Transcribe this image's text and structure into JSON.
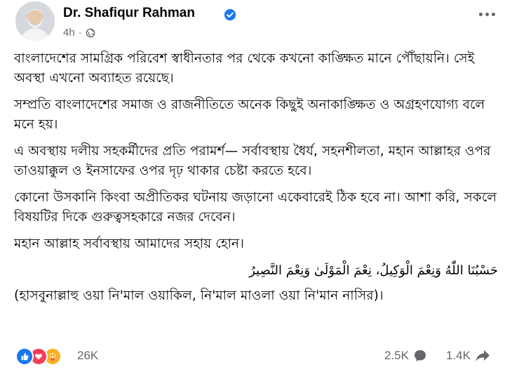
{
  "post": {
    "author": "Dr. Shafiqur Rahman",
    "time": "4h",
    "separator": "·",
    "paragraphs": [
      "বাংলাদেশের সামগ্রিক পরিবেশ স্বাধীনতার পর থেকে কখনো কাঙ্ক্ষিত মানে পৌঁছায়নি। সেই অবস্থা এখনো অব্যাহত রয়েছে।",
      "সম্প্রতি বাংলাদেশের সমাজ ও রাজনীতিতে অনেক কিছুই অনাকাঙ্ক্ষিত ও অগ্রহণযোগ্য বলে মনে হয়।",
      "এ অবস্থায় দলীয় সহকর্মীদের প্রতি পরামর্শ— সর্বাবস্থায় ধৈর্য, সহনশীলতা, মহান আল্লাহর ওপর তাওয়াক্কুল ও ইনসাফের ওপর দৃঢ় থাকার চেষ্টা করতে হবে।",
      "কোনো উসকানি কিংবা অপ্রীতিকর ঘটনায় জড়ানো একেবারেই ঠিক হবে না। আশা করি, সকলে বিষয়টির দিকে গুরুত্বসহকারে নজর দেবেন।",
      "মহান আল্লাহ সর্বাবস্থায় আমাদের সহায় হোন।"
    ],
    "arabic": "حَسْبُنَا اللّٰهُ وَنِعْمَ الْوَكِيلُ، نِعْمَ الْمَوْلَىٰ وَنِعْمَ النَّصِيرُ",
    "transliteration": "(হাসবুনাল্লাহু ওয়া নি'মাল ওয়াকিল, নি'মাল মাওলা ওয়া নি'মান নাসির)।"
  },
  "stats": {
    "reactions": "26K",
    "comments": "2.5K",
    "shares": "1.4K"
  },
  "icons": {
    "verified": "verified-badge-icon",
    "privacy": "globe-icon",
    "like": "like-reaction-icon",
    "love": "love-reaction-icon",
    "care": "care-reaction-icon",
    "comment": "comment-icon",
    "share": "share-icon"
  },
  "colors": {
    "verified": "#1877f2",
    "like": "#1877f2",
    "love": "#f33e58",
    "care": "#f7b125",
    "secondary_text": "#65676b"
  }
}
